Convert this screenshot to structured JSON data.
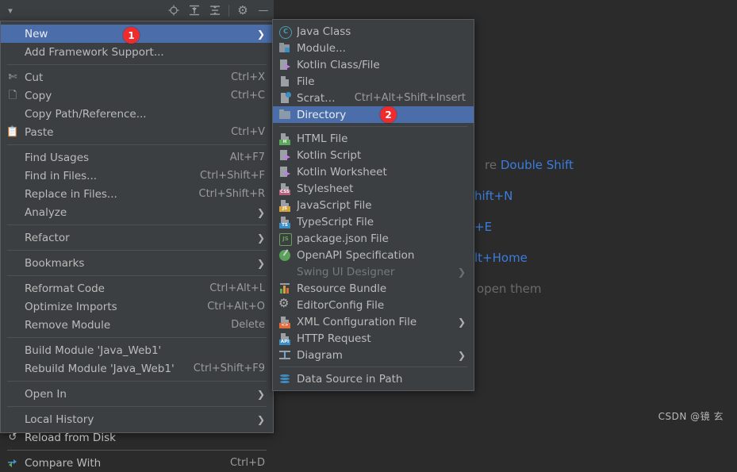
{
  "app": {
    "theme_bg": "#2b2b2b",
    "menu_bg": "#3c3f41",
    "accent": "#4b6eab",
    "badge_color": "#ef2b2b"
  },
  "toolbar": {
    "buttons": [
      {
        "name": "dropdown-chevron",
        "glyph": "▾"
      },
      {
        "name": "locate-target-icon",
        "glyph": "⊕"
      },
      {
        "name": "expand-all-icon",
        "glyph": "⤓"
      },
      {
        "name": "collapse-all-icon",
        "glyph": "⤒"
      },
      {
        "name": "settings-gear-icon",
        "glyph": "⚙"
      },
      {
        "name": "hide-minimize-icon",
        "glyph": "—"
      }
    ]
  },
  "context_menu": {
    "items": [
      {
        "type": "item",
        "label": "New",
        "mnemonic": "",
        "accel": "",
        "submenu": true,
        "selected": true,
        "icon": ""
      },
      {
        "type": "item",
        "label": "Add Framework Support...",
        "accel": "",
        "submenu": false,
        "icon": ""
      },
      {
        "type": "separator"
      },
      {
        "type": "item",
        "label": "Cut",
        "accel": "Ctrl+X",
        "submenu": false,
        "icon": "scissors-icon"
      },
      {
        "type": "item",
        "label": "Copy",
        "accel": "Ctrl+C",
        "submenu": false,
        "icon": "copy-icon"
      },
      {
        "type": "item",
        "label": "Copy Path/Reference...",
        "accel": "",
        "submenu": false,
        "icon": ""
      },
      {
        "type": "item",
        "label": "Paste",
        "accel": "Ctrl+V",
        "submenu": false,
        "icon": "paste-icon"
      },
      {
        "type": "separator"
      },
      {
        "type": "item",
        "label": "Find Usages",
        "accel": "Alt+F7",
        "submenu": false,
        "icon": ""
      },
      {
        "type": "item",
        "label": "Find in Files...",
        "accel": "Ctrl+Shift+F",
        "submenu": false,
        "icon": ""
      },
      {
        "type": "item",
        "label": "Replace in Files...",
        "accel": "Ctrl+Shift+R",
        "submenu": false,
        "icon": ""
      },
      {
        "type": "item",
        "label": "Analyze",
        "accel": "",
        "submenu": true,
        "icon": ""
      },
      {
        "type": "separator"
      },
      {
        "type": "item",
        "label": "Refactor",
        "accel": "",
        "submenu": true,
        "icon": ""
      },
      {
        "type": "separator"
      },
      {
        "type": "item",
        "label": "Bookmarks",
        "accel": "",
        "submenu": true,
        "icon": ""
      },
      {
        "type": "separator"
      },
      {
        "type": "item",
        "label": "Reformat Code",
        "accel": "Ctrl+Alt+L",
        "submenu": false,
        "icon": ""
      },
      {
        "type": "item",
        "label": "Optimize Imports",
        "accel": "Ctrl+Alt+O",
        "submenu": false,
        "icon": ""
      },
      {
        "type": "item",
        "label": "Remove Module",
        "accel": "Delete",
        "submenu": false,
        "icon": ""
      },
      {
        "type": "separator"
      },
      {
        "type": "item",
        "label": "Build Module 'Java_Web1'",
        "accel": "",
        "submenu": false,
        "icon": ""
      },
      {
        "type": "item",
        "label": "Rebuild Module 'Java_Web1'",
        "accel": "Ctrl+Shift+F9",
        "submenu": false,
        "icon": ""
      },
      {
        "type": "separator"
      },
      {
        "type": "item",
        "label": "Open In",
        "accel": "",
        "submenu": true,
        "icon": ""
      },
      {
        "type": "separator"
      },
      {
        "type": "item",
        "label": "Local History",
        "accel": "",
        "submenu": true,
        "icon": ""
      },
      {
        "type": "item",
        "label": "Reload from Disk",
        "accel": "",
        "submenu": false,
        "icon": "reload-icon"
      },
      {
        "type": "separator"
      },
      {
        "type": "item",
        "label": "Compare With",
        "accel": "Ctrl+D",
        "submenu": false,
        "icon": "compare-icon"
      }
    ]
  },
  "new_submenu": {
    "items": [
      {
        "type": "item",
        "label": "Java Class",
        "accel": "",
        "submenu": false,
        "icon": "java-class-icon"
      },
      {
        "type": "item",
        "label": "Module...",
        "accel": "",
        "submenu": false,
        "icon": "module-icon"
      },
      {
        "type": "item",
        "label": "Kotlin Class/File",
        "accel": "",
        "submenu": false,
        "icon": "kotlin-icon"
      },
      {
        "type": "item",
        "label": "File",
        "accel": "",
        "submenu": false,
        "icon": "file-icon"
      },
      {
        "type": "item",
        "label": "Scratch File",
        "accel": "Ctrl+Alt+Shift+Insert",
        "submenu": false,
        "icon": "scratch-file-icon"
      },
      {
        "type": "item",
        "label": "Directory",
        "accel": "",
        "submenu": false,
        "selected": true,
        "icon": "folder-icon"
      },
      {
        "type": "separator"
      },
      {
        "type": "item",
        "label": "HTML File",
        "accel": "",
        "submenu": false,
        "icon": "html-file-icon",
        "tag": "H",
        "tag_color": "#5ea85e"
      },
      {
        "type": "item",
        "label": "Kotlin Script",
        "accel": "",
        "submenu": false,
        "icon": "kotlin-icon"
      },
      {
        "type": "item",
        "label": "Kotlin Worksheet",
        "accel": "",
        "submenu": false,
        "icon": "kotlin-icon"
      },
      {
        "type": "item",
        "label": "Stylesheet",
        "accel": "",
        "submenu": false,
        "icon": "css-file-icon",
        "tag": "CSS",
        "tag_color": "#b5607a"
      },
      {
        "type": "item",
        "label": "JavaScript File",
        "accel": "",
        "submenu": false,
        "icon": "js-file-icon",
        "tag": "JS",
        "tag_color": "#d6a43c"
      },
      {
        "type": "item",
        "label": "TypeScript File",
        "accel": "",
        "submenu": false,
        "icon": "ts-file-icon",
        "tag": "TS",
        "tag_color": "#3b8fc6"
      },
      {
        "type": "item",
        "label": "package.json File",
        "accel": "",
        "submenu": false,
        "icon": "npm-icon"
      },
      {
        "type": "item",
        "label": "OpenAPI Specification",
        "accel": "",
        "submenu": false,
        "icon": "openapi-icon"
      },
      {
        "type": "item",
        "label": "Swing UI Designer",
        "accel": "",
        "submenu": true,
        "disabled": true,
        "icon": ""
      },
      {
        "type": "item",
        "label": "Resource Bundle",
        "accel": "",
        "submenu": false,
        "icon": "resource-bundle-icon"
      },
      {
        "type": "item",
        "label": "EditorConfig File",
        "accel": "",
        "submenu": false,
        "icon": "editorconfig-gear-icon"
      },
      {
        "type": "item",
        "label": "XML Configuration File",
        "accel": "",
        "submenu": true,
        "icon": "xml-file-icon",
        "tag": "<>",
        "tag_color": "#e06c3b"
      },
      {
        "type": "item",
        "label": "HTTP Request",
        "accel": "",
        "submenu": false,
        "icon": "http-request-icon",
        "tag": "API",
        "tag_color": "#3b8fc6"
      },
      {
        "type": "item",
        "label": "Diagram",
        "accel": "",
        "submenu": true,
        "icon": "diagram-icon"
      },
      {
        "type": "separator"
      },
      {
        "type": "item",
        "label": "Data Source in Path",
        "accel": "",
        "submenu": false,
        "icon": "database-icon"
      }
    ]
  },
  "editor_hints": {
    "rows": [
      {
        "prefix": "re",
        "key": "Double Shift",
        "suffix": ""
      },
      {
        "prefix": "",
        "key": "hift+N",
        "suffix": ""
      },
      {
        "prefix": "",
        "key": "+E",
        "suffix": ""
      },
      {
        "prefix": "",
        "key": "lt+Home",
        "suffix": ""
      },
      {
        "prefix": "",
        "key": "",
        "suffix": "open them"
      }
    ]
  },
  "watermark": {
    "text": "CSDN @镜 玄"
  },
  "badges": [
    {
      "label": "1"
    },
    {
      "label": "2"
    }
  ]
}
